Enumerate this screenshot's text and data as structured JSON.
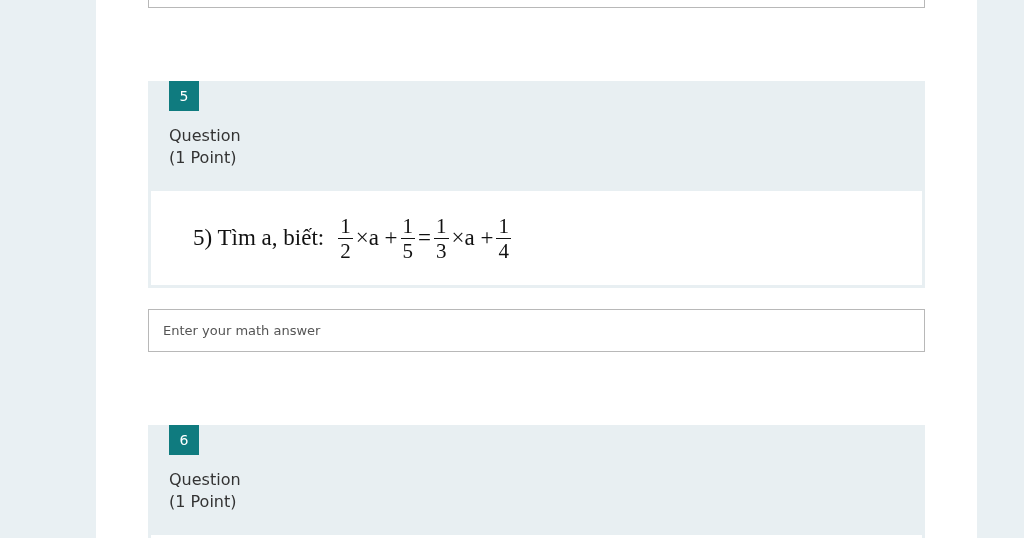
{
  "questions": [
    {
      "number": "5",
      "title": "Question",
      "points": "(1 Point)",
      "content": {
        "prefix": "5) Tìm a, biết:",
        "terms": [
          {
            "kind": "fraction",
            "numerator": "1",
            "denominator": "2"
          },
          {
            "kind": "symbol",
            "text": "×a +"
          },
          {
            "kind": "fraction",
            "numerator": "1",
            "denominator": "5"
          },
          {
            "kind": "symbol",
            "text": "="
          },
          {
            "kind": "fraction",
            "numerator": "1",
            "denominator": "3"
          },
          {
            "kind": "symbol",
            "text": "×a +"
          },
          {
            "kind": "fraction",
            "numerator": "1",
            "denominator": "4"
          }
        ]
      },
      "answer": {
        "placeholder": "Enter your math answer"
      }
    },
    {
      "number": "6",
      "title": "Question",
      "points": "(1 Point)"
    }
  ]
}
